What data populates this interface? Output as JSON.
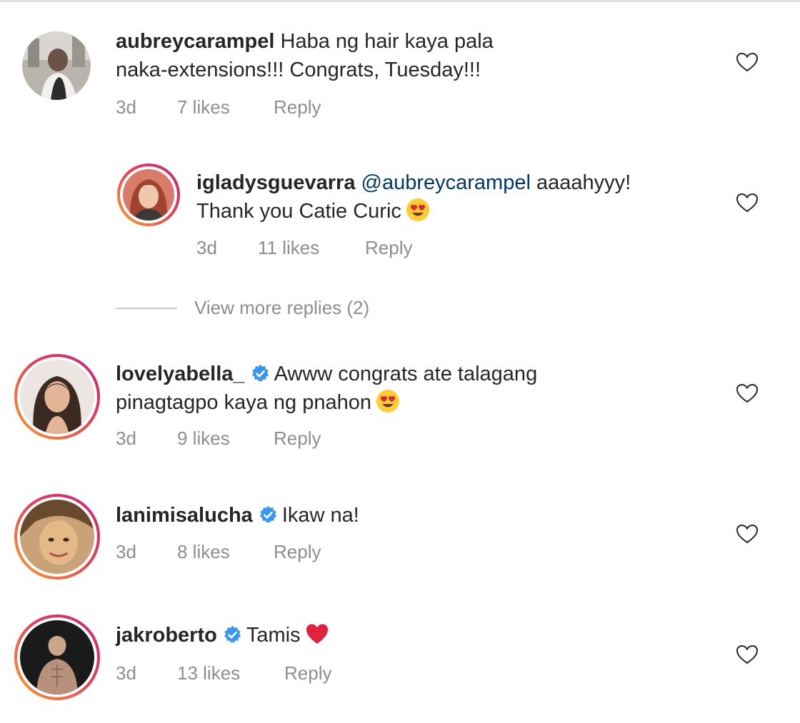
{
  "comments": [
    {
      "username": "aubreycarampel",
      "text_line1": "Haba ng hair kaya pala",
      "text_line2": "naka-extensions!!! Congrats, Tuesday!!!",
      "time": "3d",
      "likes": "7 likes",
      "reply": "Reply"
    },
    {
      "username": "igladysguevarra",
      "mention": "@aubreycarampel",
      "text_line1": "aaaahyyy!",
      "text_line2": "Thank you Catie Curic",
      "emoji": "heart-eyes-emoji",
      "time": "3d",
      "likes": "11 likes",
      "reply": "Reply"
    },
    {
      "username": "lovelyabella_",
      "verified": true,
      "text_line1": "Awww congrats ate talagang",
      "text_line2": "pinagtagpo kaya ng pnahon",
      "emoji": "heart-eyes-emoji",
      "time": "3d",
      "likes": "9 likes",
      "reply": "Reply"
    },
    {
      "username": "lanimisalucha",
      "verified": true,
      "text_line1": "Ikaw na!",
      "time": "3d",
      "likes": "8 likes",
      "reply": "Reply"
    },
    {
      "username": "jakroberto",
      "verified": true,
      "text_line1": "Tamis",
      "emoji": "red-heart-emoji",
      "time": "3d",
      "likes": "13 likes",
      "reply": "Reply"
    }
  ],
  "view_more_replies": "View more replies (2)",
  "colors": {
    "text": "#262626",
    "secondary": "#8e8e8e",
    "mention": "#00376b",
    "verified": "#3897f0",
    "story_ring_start": "#f7a22a",
    "story_ring_end": "#c4267f",
    "heart_red": "#e0223a"
  }
}
